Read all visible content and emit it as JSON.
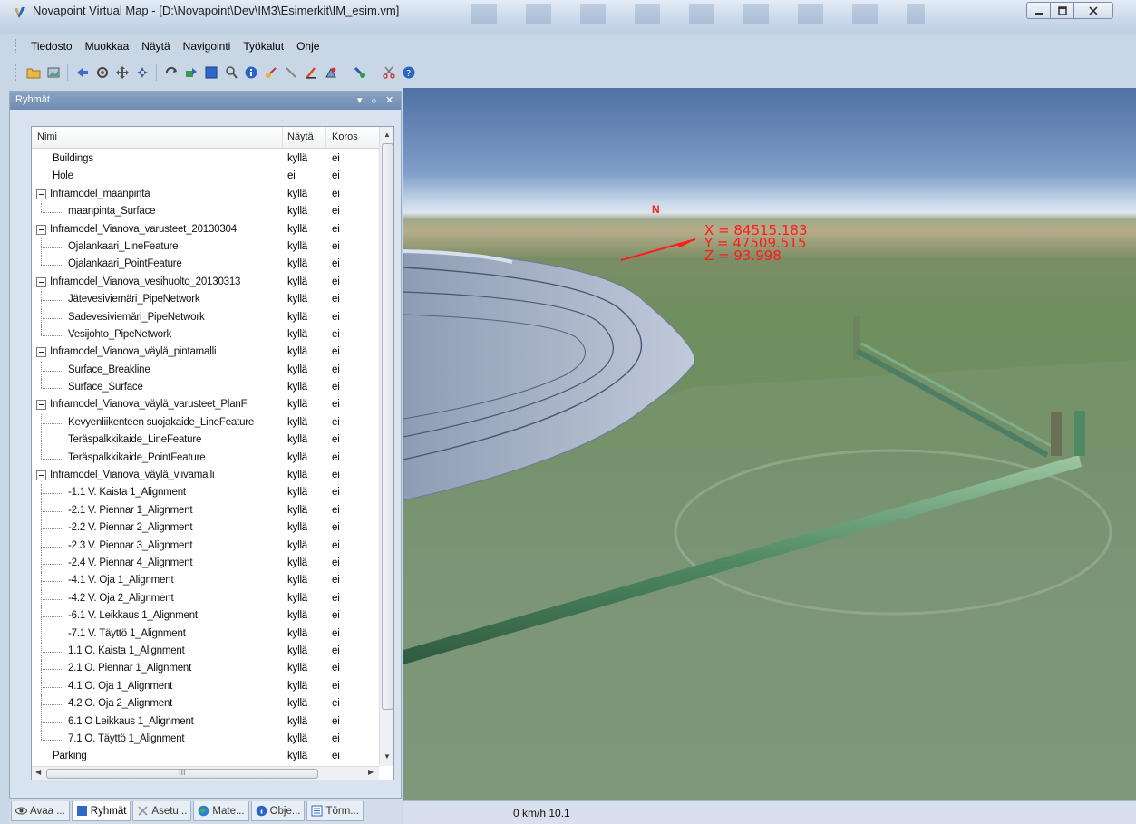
{
  "window": {
    "title": "Novapoint Virtual Map - [D:\\Novapoint\\Dev\\IM3\\Esimerkit\\IM_esim.vm]"
  },
  "menu": [
    "Tiedosto",
    "Muokkaa",
    "Näytä",
    "Navigointi",
    "Työkalut",
    "Ohje"
  ],
  "toolbar_icons": [
    "folder-open-icon",
    "image-icon",
    "arrow-left-icon",
    "rotate-icon",
    "move-icon",
    "pan-icon",
    "orbit-icon",
    "walk-icon",
    "layer-icon",
    "zoom-icon",
    "info-icon",
    "measure-icon",
    "ruler-icon",
    "draw-icon",
    "settings-icon",
    "paint-icon",
    "scissors-icon",
    "help-icon"
  ],
  "panel": {
    "title": "Ryhmät",
    "columns": {
      "name": "Nimi",
      "show": "Näytä",
      "elevation": "Koros"
    },
    "rows": [
      {
        "name": "Buildings",
        "show": "kyllä",
        "kor": "ei",
        "level": 0
      },
      {
        "name": "Hole",
        "show": "ei",
        "kor": "ei",
        "level": 0
      },
      {
        "name": "Inframodel_maanpinta",
        "show": "kyllä",
        "kor": "ei",
        "level": 0,
        "group": true
      },
      {
        "name": "maanpinta_Surface",
        "show": "kyllä",
        "kor": "ei",
        "level": 1,
        "last": true
      },
      {
        "name": "Inframodel_Vianova_varusteet_20130304",
        "show": "kyllä",
        "kor": "ei",
        "level": 0,
        "group": true
      },
      {
        "name": "Ojalankaari_LineFeature",
        "show": "kyllä",
        "kor": "ei",
        "level": 1
      },
      {
        "name": "Ojalankaari_PointFeature",
        "show": "kyllä",
        "kor": "ei",
        "level": 1,
        "last": true
      },
      {
        "name": "Inframodel_Vianova_vesihuolto_20130313",
        "show": "kyllä",
        "kor": "ei",
        "level": 0,
        "group": true
      },
      {
        "name": "Jätevesiviemäri_PipeNetwork",
        "show": "kyllä",
        "kor": "ei",
        "level": 1
      },
      {
        "name": "Sadevesiviemäri_PipeNetwork",
        "show": "kyllä",
        "kor": "ei",
        "level": 1
      },
      {
        "name": "Vesijohto_PipeNetwork",
        "show": "kyllä",
        "kor": "ei",
        "level": 1,
        "last": true
      },
      {
        "name": "Inframodel_Vianova_väylä_pintamalli",
        "show": "kyllä",
        "kor": "ei",
        "level": 0,
        "group": true
      },
      {
        "name": "Surface_Breakline",
        "show": "kyllä",
        "kor": "ei",
        "level": 1
      },
      {
        "name": "Surface_Surface",
        "show": "kyllä",
        "kor": "ei",
        "level": 1,
        "last": true
      },
      {
        "name": "Inframodel_Vianova_väylä_varusteet_PlanF",
        "show": "kyllä",
        "kor": "ei",
        "level": 0,
        "group": true
      },
      {
        "name": "Kevyenliikenteen suojakaide_LineFeature",
        "show": "kyllä",
        "kor": "ei",
        "level": 1
      },
      {
        "name": "Teräspalkkikaide_LineFeature",
        "show": "kyllä",
        "kor": "ei",
        "level": 1
      },
      {
        "name": "Teräspalkkikaide_PointFeature",
        "show": "kyllä",
        "kor": "ei",
        "level": 1,
        "last": true
      },
      {
        "name": "Inframodel_Vianova_väylä_viivamalli",
        "show": "kyllä",
        "kor": "ei",
        "level": 0,
        "group": true
      },
      {
        "name": "-1.1 V. Kaista 1_Alignment",
        "show": "kyllä",
        "kor": "ei",
        "level": 1
      },
      {
        "name": "-2.1 V. Piennar 1_Alignment",
        "show": "kyllä",
        "kor": "ei",
        "level": 1
      },
      {
        "name": "-2.2 V. Piennar 2_Alignment",
        "show": "kyllä",
        "kor": "ei",
        "level": 1
      },
      {
        "name": "-2.3 V. Piennar 3_Alignment",
        "show": "kyllä",
        "kor": "ei",
        "level": 1
      },
      {
        "name": "-2.4 V. Piennar 4_Alignment",
        "show": "kyllä",
        "kor": "ei",
        "level": 1
      },
      {
        "name": "-4.1 V. Oja 1_Alignment",
        "show": "kyllä",
        "kor": "ei",
        "level": 1
      },
      {
        "name": "-4.2 V. Oja 2_Alignment",
        "show": "kyllä",
        "kor": "ei",
        "level": 1
      },
      {
        "name": "-6.1 V. Leikkaus 1_Alignment",
        "show": "kyllä",
        "kor": "ei",
        "level": 1
      },
      {
        "name": "-7.1 V. Täyttö 1_Alignment",
        "show": "kyllä",
        "kor": "ei",
        "level": 1
      },
      {
        "name": "1.1 O. Kaista 1_Alignment",
        "show": "kyllä",
        "kor": "ei",
        "level": 1
      },
      {
        "name": "2.1 O. Piennar 1_Alignment",
        "show": "kyllä",
        "kor": "ei",
        "level": 1
      },
      {
        "name": "4.1 O. Oja 1_Alignment",
        "show": "kyllä",
        "kor": "ei",
        "level": 1
      },
      {
        "name": "4.2 O. Oja 2_Alignment",
        "show": "kyllä",
        "kor": "ei",
        "level": 1
      },
      {
        "name": "6.1 O Leikkaus 1_Alignment",
        "show": "kyllä",
        "kor": "ei",
        "level": 1
      },
      {
        "name": "7.1 O. Täyttö 1_Alignment",
        "show": "kyllä",
        "kor": "ei",
        "level": 1,
        "last": true
      },
      {
        "name": "Parking",
        "show": "kyllä",
        "kor": "ei",
        "level": 0
      }
    ],
    "hscroll_label": "III"
  },
  "tabs": [
    {
      "label": "Avaa ...",
      "icon": "eye-icon"
    },
    {
      "label": "Ryhmät",
      "icon": "groups-icon",
      "active": true
    },
    {
      "label": "Asetu...",
      "icon": "settings-icon"
    },
    {
      "label": "Mate...",
      "icon": "globe-icon"
    },
    {
      "label": "Obje...",
      "icon": "object-icon"
    },
    {
      "label": "Törm...",
      "icon": "list-icon"
    }
  ],
  "viewport": {
    "north": "N",
    "x": "X = 84515.183",
    "y": "Y = 47509.515",
    "z": "Z = 93.998"
  },
  "status": {
    "speed": "0 km/h  10.1"
  },
  "colors": {
    "coords": "#ff1b1b",
    "panel_header": "#7b97bc"
  }
}
